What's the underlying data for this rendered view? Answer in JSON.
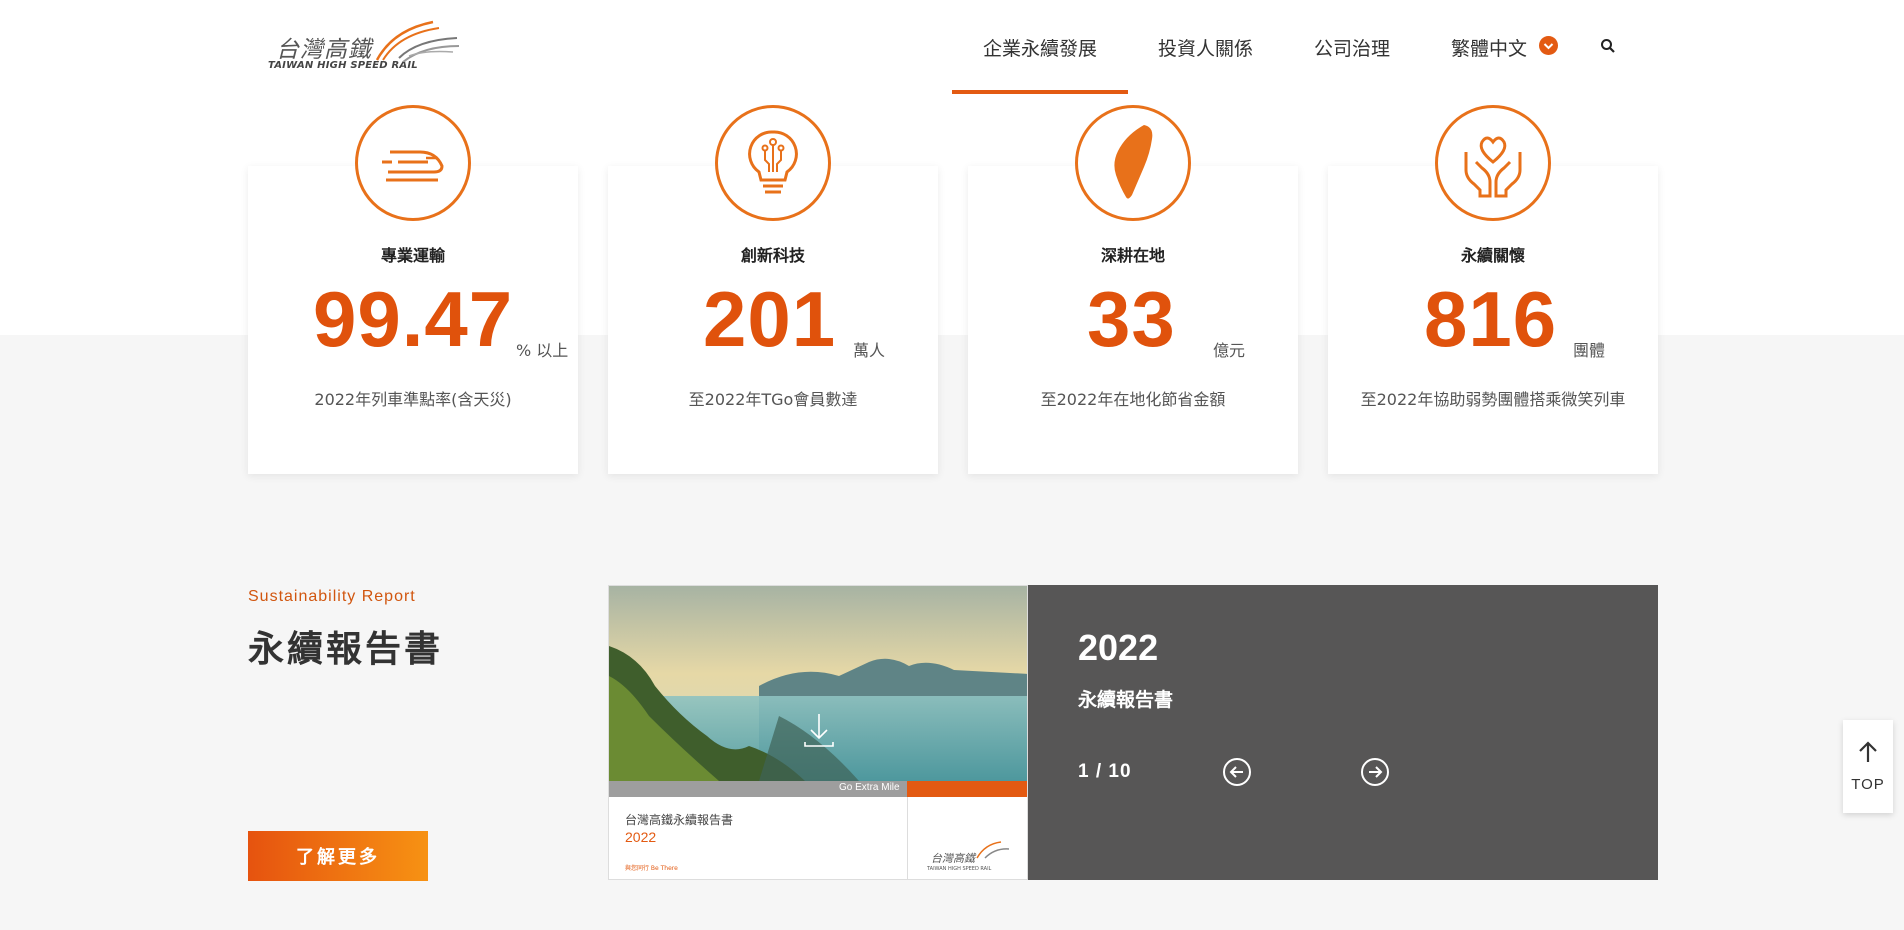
{
  "header": {
    "logo_cn": "台灣高鐵",
    "logo_en": "TAIWAN HIGH SPEED RAIL",
    "nav": [
      {
        "label": "企業永續發展",
        "active": true
      },
      {
        "label": "投資人關係",
        "active": false
      },
      {
        "label": "公司治理",
        "active": false
      },
      {
        "label": "繁體中文",
        "active": false
      }
    ],
    "search_icon": "search-icon",
    "lang_icon": "chevron-down-icon",
    "accent_color": "#e35a12"
  },
  "stats": [
    {
      "icon": "train-icon",
      "title": "專業運輸",
      "value": "99.47",
      "unit": "% 以上",
      "desc": "2022年列車準點率(含天災)"
    },
    {
      "icon": "lightbulb-icon",
      "title": "創新科技",
      "value": "201",
      "unit": "萬人",
      "desc": "至2022年TGo會員數達"
    },
    {
      "icon": "taiwan-map-icon",
      "title": "深耕在地",
      "value": "33",
      "unit": "億元",
      "desc": "至2022年在地化節省金額"
    },
    {
      "icon": "heart-hands-icon",
      "title": "永續關懷",
      "value": "816",
      "unit": "團體",
      "desc": "至2022年協助弱勢團體搭乘微笑列車"
    }
  ],
  "report": {
    "label_en": "Sustainability Report",
    "title": "永續報告書",
    "more_button": "了解更多",
    "cover": {
      "tagline": "Go Extra Mile",
      "book_title": "台灣高鐵永續報告書",
      "book_year": "2022",
      "footer_note": "與您同行 Be There",
      "logo_cn": "台灣高鐵",
      "logo_en": "TAIWAN HIGH SPEED RAIL"
    },
    "panel": {
      "year": "2022",
      "subtitle": "永續報告書",
      "pagination": "1 / 10",
      "prev_icon": "arrow-left-circle-icon",
      "next_icon": "arrow-right-circle-icon"
    }
  },
  "back_to_top": {
    "label": "TOP",
    "icon": "arrow-up-icon"
  }
}
